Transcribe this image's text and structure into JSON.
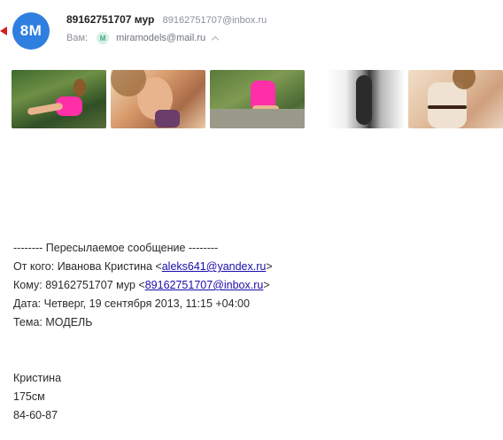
{
  "avatar": {
    "initials": "8M",
    "color": "#2f7fe0"
  },
  "header": {
    "sender_name": "89162751707 мур",
    "sender_email": "89162751707@inbox.ru",
    "to_prefix": "Вам:",
    "recipient_avatar": "M",
    "recipient_email": "miramodels@mail.ru"
  },
  "attachments": [
    {
      "name": "photo-1"
    },
    {
      "name": "photo-2"
    },
    {
      "name": "photo-3"
    },
    {
      "name": "photo-4"
    },
    {
      "name": "photo-5"
    }
  ],
  "forwarded": {
    "separator": "-------- Пересылаемое сообщение --------",
    "from_label": "От кого:",
    "from_name": "Иванова Кристина",
    "from_email": "aleks641@yandex.ru",
    "to_label": "Кому:",
    "to_name": "89162751707 мур",
    "to_email": "89162751707@inbox.ru",
    "date_label": "Дата:",
    "date_value": "Четверг, 19 сентября 2013, 11:15 +04:00",
    "subject_label": "Тема:",
    "subject_value": "МОДЕЛЬ"
  },
  "message": {
    "line1": "Кристина",
    "line2": "175см",
    "line3": "84-60-87"
  }
}
